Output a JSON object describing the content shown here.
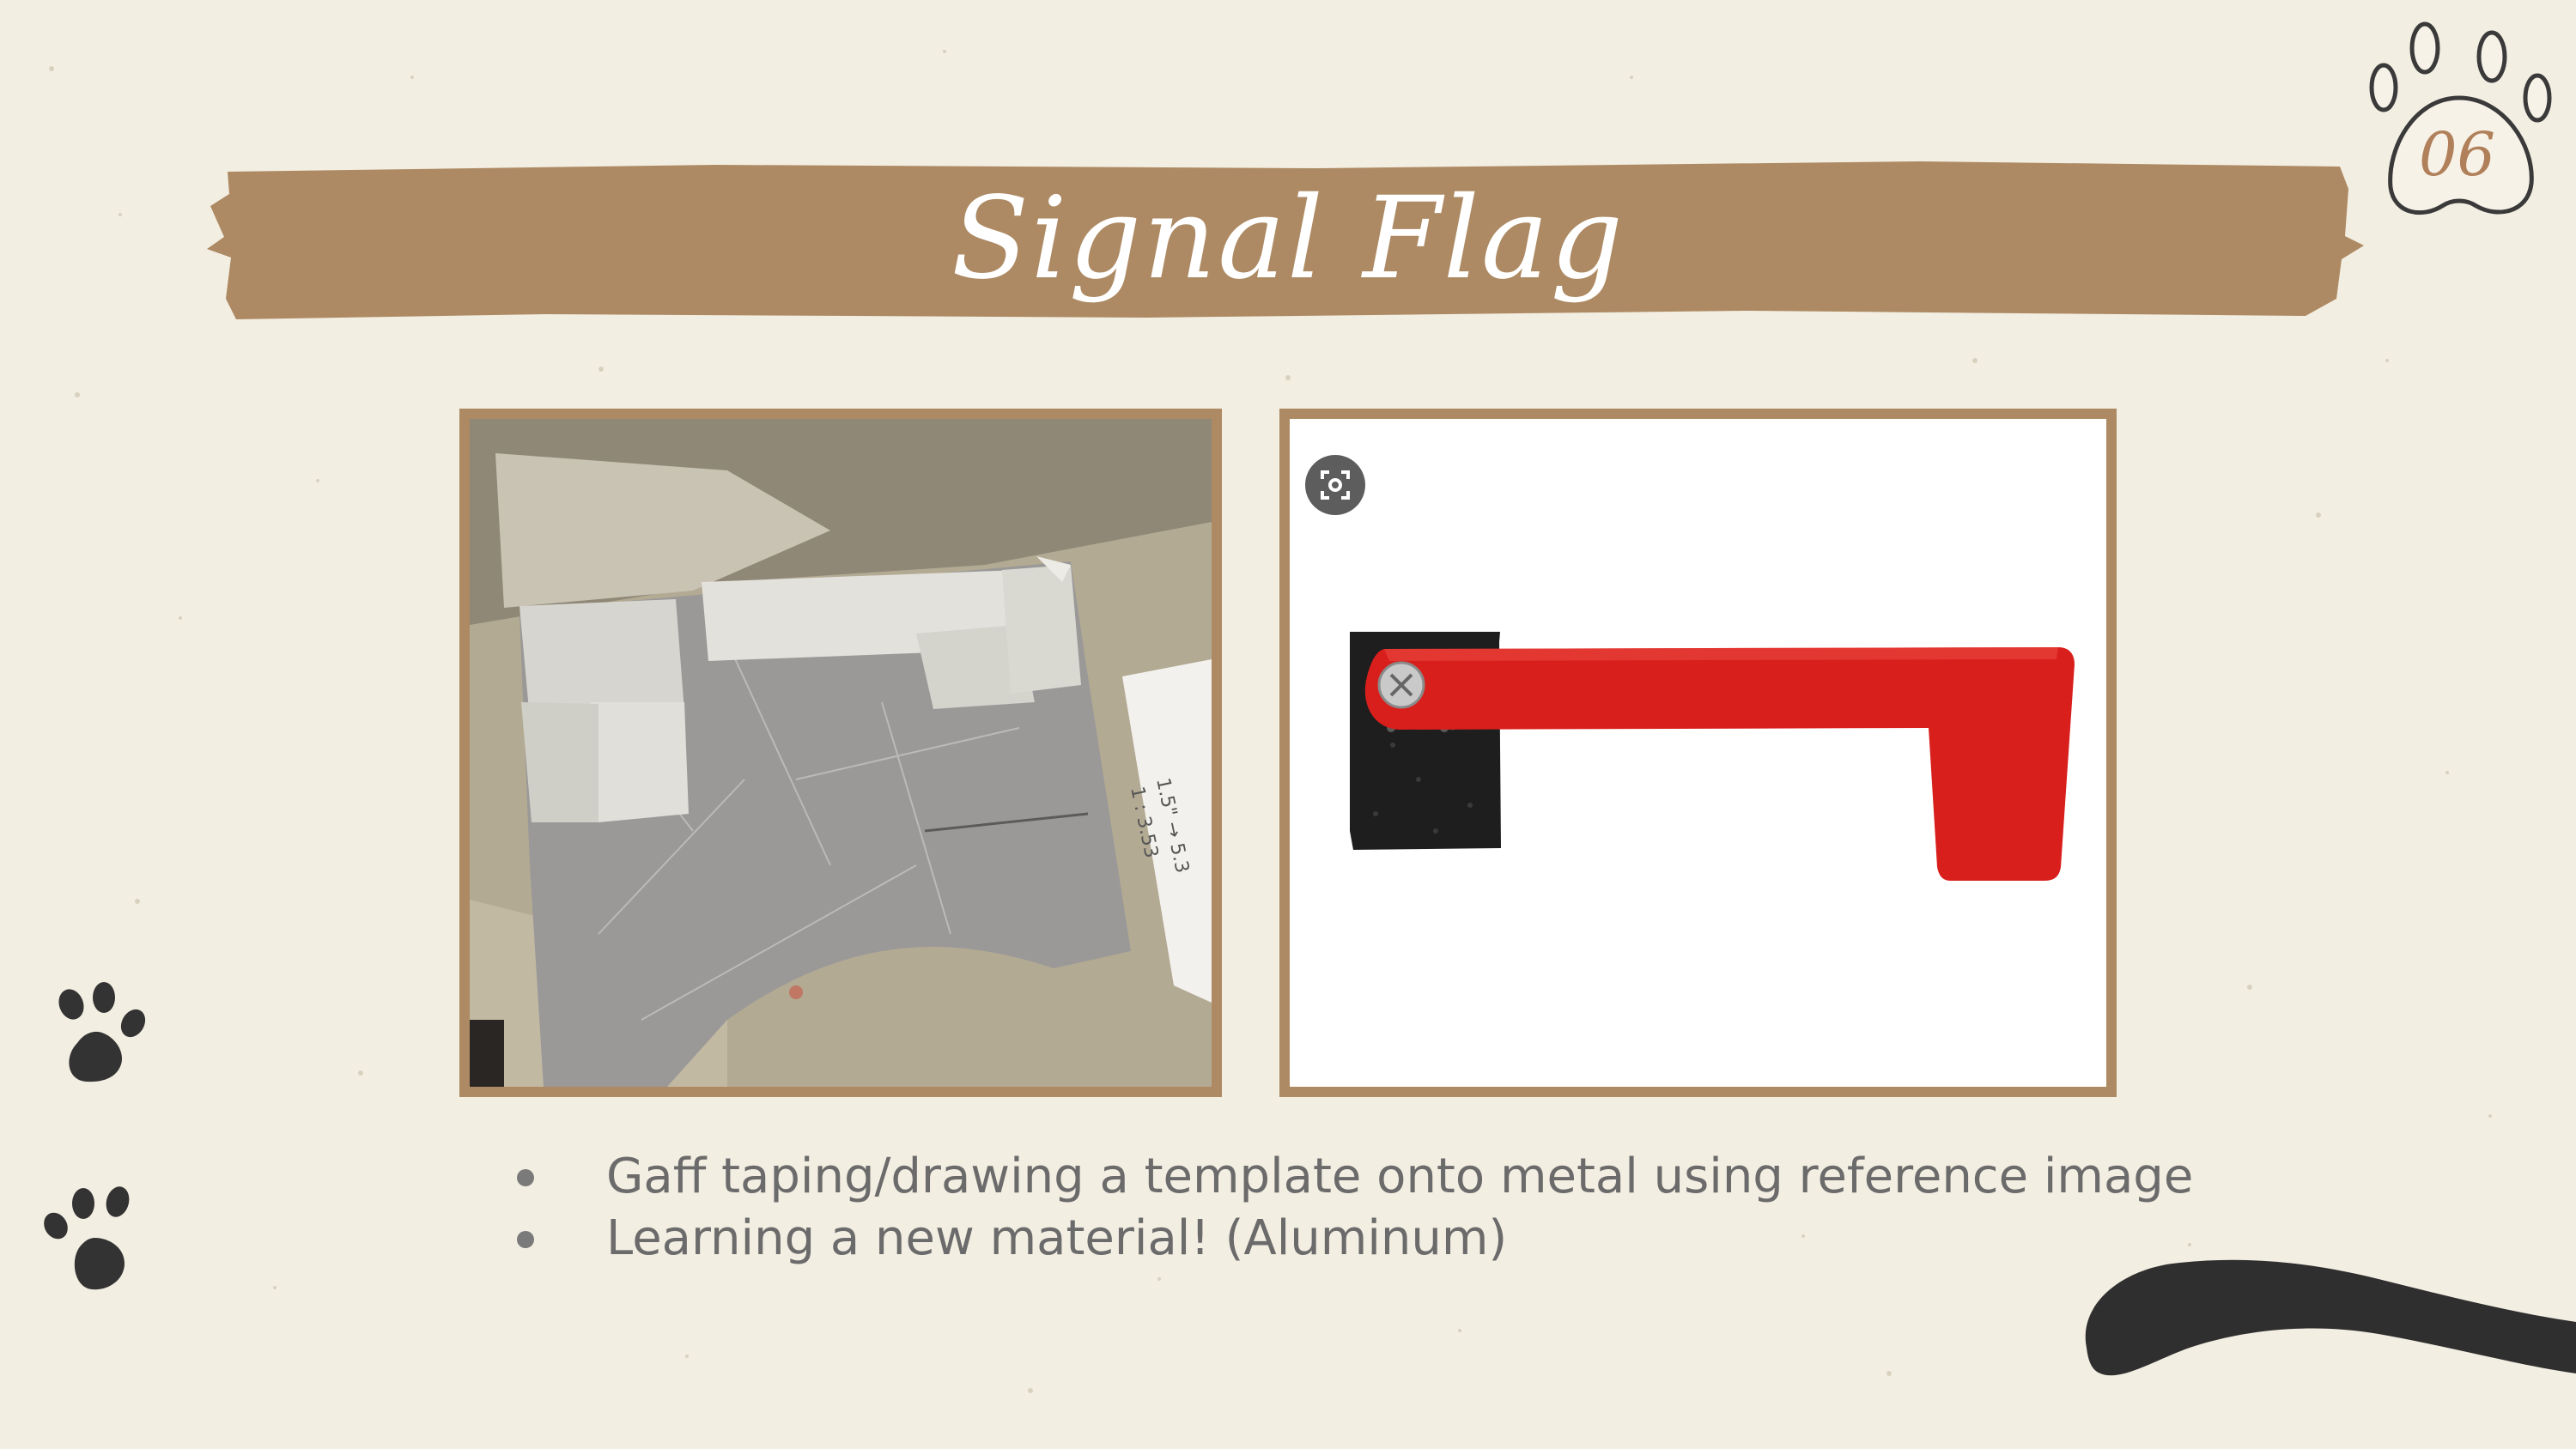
{
  "slide": {
    "title": "Signal Flag",
    "page_number": "06",
    "bullets": [
      "Gaff taping/drawing a template onto metal using reference image",
      "Learning a new material! (Aluminum)"
    ],
    "photo_template": {
      "note_lines": [
        "1.5\" → 5.3",
        "1 : 3.53"
      ]
    }
  },
  "theme": {
    "background": "#f3eee2",
    "banner": "#ad8a63",
    "frame": "#ad8a63",
    "paw_dark": "#333333",
    "text": "#6b6b6b",
    "flag_red": "#d81f1c"
  },
  "icons": {
    "lens": "visual-search-icon",
    "badge": "paw-print-icon",
    "decor": [
      "paw-prints-icon",
      "cat-tail-icon"
    ]
  }
}
